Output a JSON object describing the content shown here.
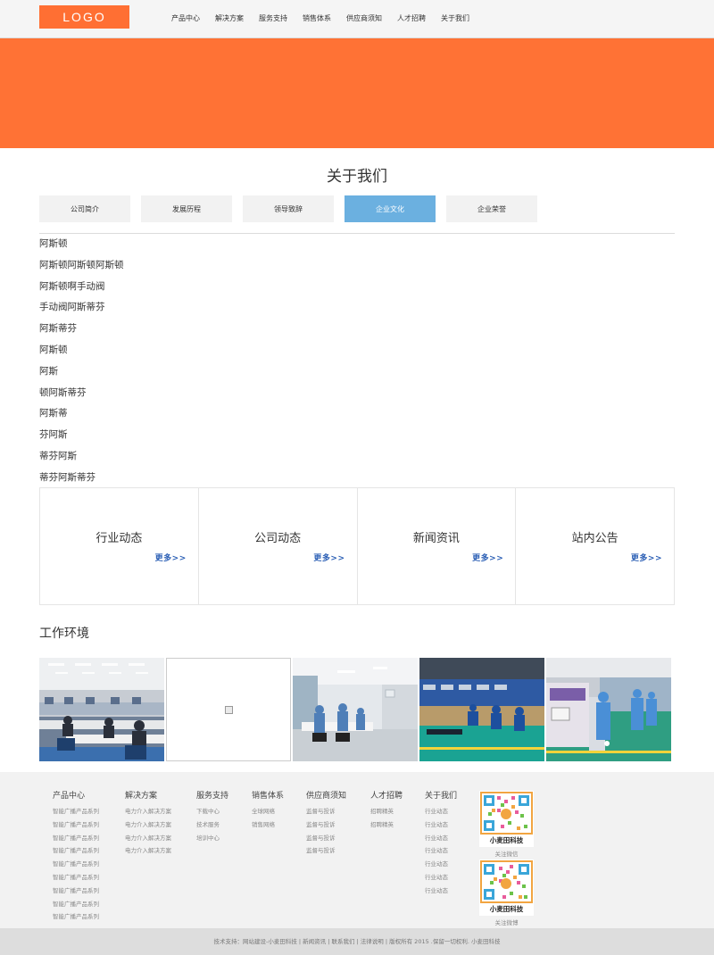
{
  "header": {
    "logo": "LOGO",
    "nav": [
      "产品中心",
      "解决方案",
      "服务支持",
      "销售体系",
      "供应商须知",
      "人才招聘",
      "关于我们"
    ]
  },
  "about": {
    "title": "关于我们",
    "tabs": [
      "公司简介",
      "发展历程",
      "领导致辞",
      "企业文化",
      "企业荣誉"
    ],
    "active_tab": "企业文化",
    "items": [
      "阿斯顿",
      "阿斯顿阿斯顿阿斯顿",
      "阿斯顿啊手动阀",
      "手动阀阿斯蒂芬",
      "阿斯蒂芬",
      "阿斯顿",
      "阿斯",
      "顿阿斯蒂芬",
      "阿斯蒂",
      "芬阿斯",
      "蒂芬阿斯",
      "蒂芬阿斯蒂芬"
    ]
  },
  "news": [
    {
      "title": "行业动态",
      "more": "更多>>"
    },
    {
      "title": "公司动态",
      "more": "更多>>"
    },
    {
      "title": "新闻资讯",
      "more": "更多>>"
    },
    {
      "title": "站内公告",
      "more": "更多>>"
    }
  ],
  "environment": {
    "title": "工作环境"
  },
  "footer": {
    "columns": [
      {
        "title": "产品中心",
        "links": [
          "智能广播产品系列",
          "智能广播产品系列",
          "智能广播产品系列",
          "智能广播产品系列",
          "智能广播产品系列",
          "智能广播产品系列",
          "智能广播产品系列",
          "智能广播产品系列",
          "智能广播产品系列"
        ]
      },
      {
        "title": "解决方案",
        "links": [
          "电力介入解决方案",
          "电力介入解决方案",
          "电力介入解决方案",
          "电力介入解决方案"
        ]
      },
      {
        "title": "服务支持",
        "links": [
          "下载中心",
          "技术服务",
          "培训中心"
        ]
      },
      {
        "title": "销售体系",
        "links": [
          "全球网络",
          "销售网络"
        ]
      },
      {
        "title": "供应商须知",
        "links": [
          "监督与投诉",
          "监督与投诉",
          "监督与投诉",
          "监督与投诉"
        ]
      },
      {
        "title": "人才招聘",
        "links": [
          "招聘精英",
          "招聘精英"
        ]
      },
      {
        "title": "关于我们",
        "links": [
          "行业动态",
          "行业动态",
          "行业动态",
          "行业动态",
          "行业动态",
          "行业动态",
          "行业动态"
        ]
      }
    ],
    "qr": [
      {
        "label": "小麦田科技",
        "caption": "关注微信"
      },
      {
        "label": "小麦田科技",
        "caption": "关注微博"
      }
    ],
    "copyright": "技术支持：网站建设-小麦田科技 | 新闻资讯 | 联系我们 | 法律说明 | 版权所有 2015 .保留一切权利. 小麦田科技"
  },
  "colors": {
    "accent": "#ff7235",
    "active_tab": "#6bb0e0",
    "more_link": "#2b5fb5"
  }
}
